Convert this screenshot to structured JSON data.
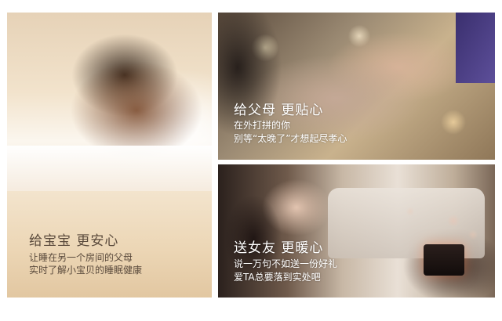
{
  "panels": [
    {
      "theme": "baby",
      "headline": "给宝宝 更安心",
      "lines": [
        "让睡在另一个房间的父母",
        "实时了解小宝贝的睡眠健康"
      ],
      "text_color": "#5a4a3c"
    },
    {
      "theme": "parents",
      "headline": "给父母 更贴心",
      "lines": [
        "在外打拼的你",
        "别等“太晚了”才想起尽孝心"
      ],
      "text_color": "#ffffff"
    },
    {
      "theme": "girlfriend",
      "headline": "送女友 更暖心",
      "lines": [
        "说一万句不如送一份好礼",
        "爱TA总要落到实处吧"
      ],
      "text_color": "#ffffff"
    }
  ]
}
